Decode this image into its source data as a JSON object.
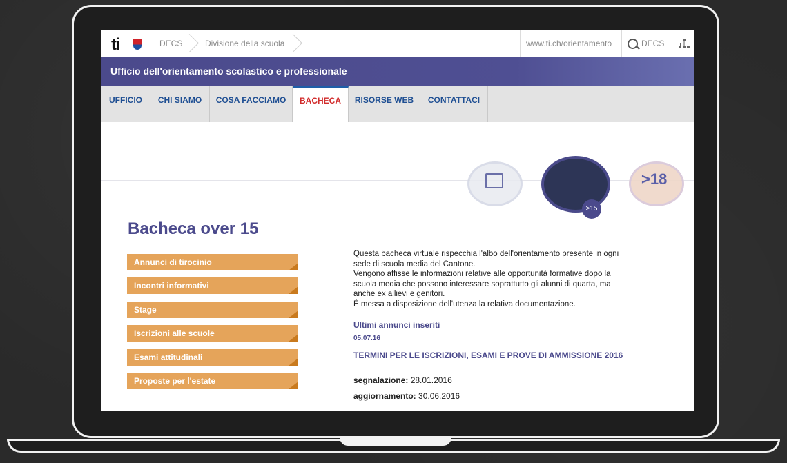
{
  "topbar": {
    "crumbs": [
      "DECS",
      "Divisione della scuola"
    ],
    "url": "www.ti.ch/orientamento",
    "search_label": "DECS",
    "logo_text": "ti"
  },
  "header": {
    "title": "Ufficio dell'orientamento scolastico e professionale"
  },
  "nav": {
    "tabs": [
      "UFFICIO",
      "CHI SIAMO",
      "COSA FACCIAMO",
      "BACHECA",
      "RISORSE WEB",
      "CONTATTACI"
    ],
    "active": "BACHECA"
  },
  "hero": {
    "badge": ">15",
    "right_label": ">18"
  },
  "page": {
    "title": "Bacheca over 15",
    "menu": [
      "Annunci di tirocinio",
      "Incontri informativi",
      "Stage",
      "Iscrizioni alle scuole",
      "Esami attitudinali",
      "Proposte per l'estate"
    ],
    "desc_lines": [
      "Questa bacheca virtuale rispecchia l'albo dell'orientamento presente in ogni",
      "sede di scuola media del Cantone.",
      "Vengono affisse le informazioni relative alle opportunità formative dopo la",
      "scuola media che possono interessare soprattutto gli alunni di quarta, ma",
      "anche ex allievi e genitori.",
      "È messa a disposizione dell'utenza la relativa documentazione."
    ],
    "latest_heading": "Ultimi annunci inseriti",
    "latest_date": "05.07.16",
    "news_title": "TERMINI PER LE ISCRIZIONI, ESAMI E PROVE DI AMMISSIONE 2016",
    "segnalazione_label": "segnalazione:",
    "segnalazione_value": "28.01.2016",
    "aggiornamento_label": "aggiornamento:",
    "aggiornamento_value": "30.06.2016"
  }
}
